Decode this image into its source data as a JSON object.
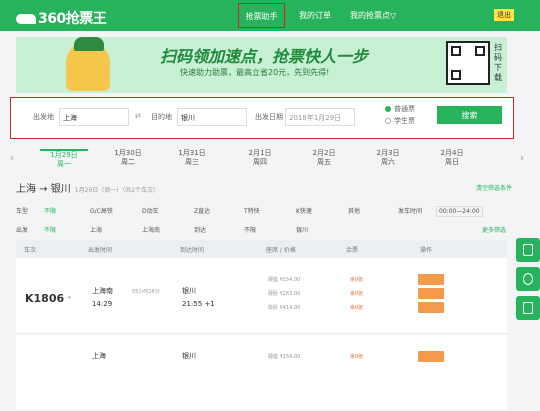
{
  "header": {
    "logo": "360抢票王",
    "nav": [
      "抢票助手",
      "我的订单",
      "我的抢票点▽"
    ],
    "phone": "",
    "exit": "退出"
  },
  "banner": {
    "title": "扫码领加速点，抢票快人一步",
    "subtitle": "快速助力助票，最高立省20元，先到先得!",
    "qr_label": "扫码下载"
  },
  "search": {
    "from_label": "出发地",
    "from_value": "上海",
    "to_label": "目的地",
    "to_value": "银川",
    "date_label": "出发日期",
    "date_value": "2018年1月29日",
    "opt_normal": "普通票",
    "opt_student": "学生票",
    "button": "搜索"
  },
  "dates": [
    {
      "d": "1月29日",
      "w": "周一"
    },
    {
      "d": "1月30日",
      "w": "周二"
    },
    {
      "d": "1月31日",
      "w": "周三"
    },
    {
      "d": "2月1日",
      "w": "周四"
    },
    {
      "d": "2月2日",
      "w": "周五"
    },
    {
      "d": "2月3日",
      "w": "周六"
    },
    {
      "d": "2月4日",
      "w": "周日"
    }
  ],
  "route": {
    "from": "上海",
    "to": "银川",
    "sub": "1月29日（周一）（共2个车次）",
    "clear": "清空筛选条件"
  },
  "filters": {
    "row1": [
      "车型",
      "不限",
      "G/C高铁",
      "D动车",
      "Z直达",
      "T特快",
      "K快速",
      "其他",
      "发车时间",
      "00:00—24:00"
    ],
    "row2": [
      "出发",
      "不限",
      "上海",
      "上海南",
      "到达",
      "不限",
      "银川",
      "",
      "",
      "更多筛选"
    ]
  },
  "table": {
    "headers": [
      "车次",
      "出发时间",
      "到达时间",
      "座席 / 价格",
      "余票",
      "操作"
    ]
  },
  "rows": [
    {
      "no": "K1806",
      "from": "上海南",
      "dep": "14:29",
      "to": "银川",
      "arr": "21:55 +1",
      "seats": [
        "硬座 ¥154.00",
        "硬卧 ¥263.00",
        "软卧 ¥414.00"
      ],
      "left": [
        "余0张",
        "余0张",
        "余0张"
      ],
      "info": "55小时26分"
    },
    {
      "no": "",
      "from": "上海",
      "dep": "",
      "to": "银川",
      "arr": "",
      "seats": [
        "硬座 ¥154.00"
      ],
      "left": [
        "余0张"
      ],
      "info": ""
    }
  ],
  "colors": {
    "brand": "#27b35b",
    "highlight": "#d42525",
    "accent": "#f39b4a"
  }
}
